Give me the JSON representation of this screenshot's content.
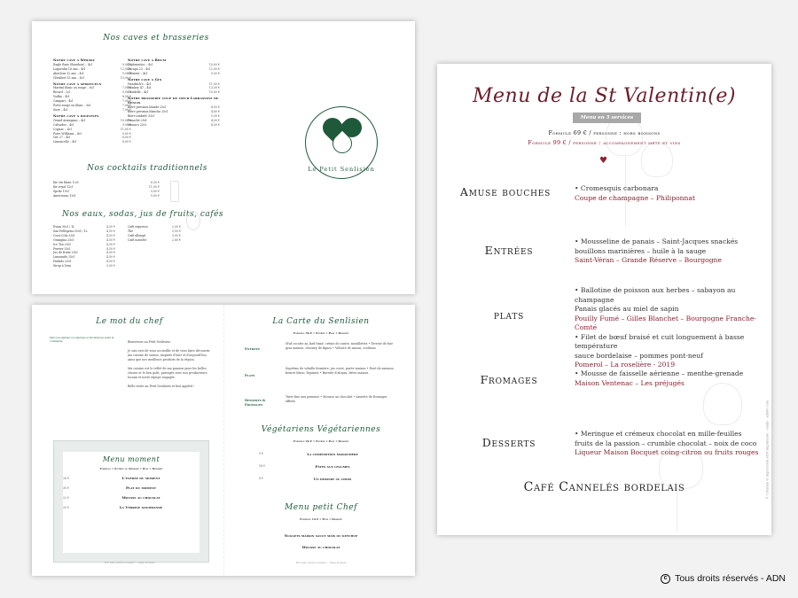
{
  "sheet_a": {
    "title_caves": "Nos caves et brasseries",
    "col1": [
      {
        "heading": "Notre cave à Whisky",
        "items": [
          [
            "Eagle Rare (Bourbon) – 4cl",
            "9,00 €"
          ],
          [
            "Lagavulin 16 ans – 4cl",
            "12,00 €"
          ],
          [
            "Aberlour 12 ans – 4cl",
            "9,00 €"
          ],
          [
            "Glenlivet 15 ans – 4cl",
            "10,00 €"
          ]
        ]
      },
      {
        "heading": "Notre cave à spiritueux",
        "items": [
          [
            "Martini blanc ou rouge – 6cl",
            "7,00 €"
          ],
          [
            "Ricard – 2cl",
            "5,50 €"
          ],
          [
            "Vodka – 4cl",
            "8,00 €"
          ],
          [
            "Campari – 4cl",
            "7,00 €"
          ],
          [
            "Porto rouge ou blanc – 6cl",
            "7,00 €"
          ],
          [
            "Suze – 4cl",
            "7,00 €"
          ]
        ]
      },
      {
        "heading": "Notre cave à digestifs",
        "items": [
          [
            "Grand Armagnac – 4cl",
            "10,00 €"
          ],
          [
            "Calvados – 4cl",
            "9,00 €"
          ],
          [
            "Cognac – 4cl",
            "11,00 €"
          ],
          [
            "Poire Williams – 4cl",
            "9,00 €"
          ],
          [
            "Get 27 – 4cl",
            "8,00 €"
          ],
          [
            "Limoncello – 4cl",
            "8,00 €"
          ]
        ]
      }
    ],
    "col2": [
      {
        "heading": "Notre cave à Rhum",
        "items": [
          [
            "Diplomatico – 4cl",
            "10,00 €"
          ],
          [
            "Zacapa 23 – 4cl",
            "12,00 €"
          ],
          [
            "Clément – 4cl",
            "9,00 €"
          ]
        ]
      },
      {
        "heading": "Notre cave à Gin",
        "items": [
          [
            "Hendrick's – 4cl",
            "11,00 €"
          ],
          [
            "Monkey 47 – 4cl",
            "13,00 €"
          ],
          [
            "Citadelle – 4cl",
            "10,00 €"
          ]
        ]
      },
      {
        "heading": "Notre brasserie coup de cœur Larrassine de Senlis",
        "items": [
          [
            "Bière pression blonde 25cl",
            "4,50 €"
          ],
          [
            "Bière pression blanche 25cl",
            "4,80 €"
          ],
          [
            "Bière ambrée 33cl",
            "5,50 €"
          ],
          [
            "Panaché 25cl",
            "4,00 €"
          ],
          [
            "Monaco 25cl",
            "4,50 €"
          ]
        ]
      }
    ],
    "logo_text": "Le Petit Senlisien",
    "title_cocktails": "Nos cocktails traditionnels",
    "cocktails": [
      [
        "Kir vin blanc 12cl",
        "6,50 €"
      ],
      [
        "Kir royal 12cl",
        "11,00 €"
      ],
      [
        "Spritz 15cl",
        "9,00 €"
      ],
      [
        "Americano 15cl",
        "9,00 €"
      ]
    ],
    "title_softs": "Nos eaux, sodas, jus de fruits, cafés",
    "softs1": [
      [
        "Evian 50cl / 1L",
        "4,50 €"
      ],
      [
        "San Pellegrino 50cl / 1L",
        "4,50 €"
      ],
      [
        "Coca-Cola 33cl",
        "4,50 €"
      ],
      [
        "Orangina 25cl",
        "4,50 €"
      ],
      [
        "Ice Tea 25cl",
        "4,50 €"
      ],
      [
        "Perrier 33cl",
        "4,50 €"
      ],
      [
        "Jus de fruits 25cl",
        "4,50 €"
      ],
      [
        "Limonade 25cl",
        "4,50 €"
      ],
      [
        "Diabolo 25cl",
        "4,50 €"
      ],
      [
        "Sirop à l'eau",
        "3,00 €"
      ]
    ],
    "softs2": [
      [
        "Café expresso",
        "2,50 €"
      ],
      [
        "Thé",
        "3,50 €"
      ],
      [
        "Café allongé",
        "3,00 €"
      ],
      [
        "Café noisette",
        "2,80 €"
      ]
    ]
  },
  "sheet_b": {
    "title_chef": "Le mot du chef",
    "chef_p1": "Bienvenue au Petit Senlisien.",
    "chef_p2": "Je suis ravi de vous accueillir et de vous faire découvrir ma cuisine de saison, inspirée d'hier et d'aujourd'hui, ainsi que nos meilleurs produits de la région.",
    "chef_p3": "Ma cuisine est le reflet de ma passion pour les belles choses et le bon goût, partagée avec nos producteurs locaux et notre équipe engagée.",
    "chef_p4": "Belle visite au Petit Senlisien et bon appétit !",
    "chef_note": "Merci de signaler vos allergies et intolérances avant la commande.",
    "title_moment": "Menu moment",
    "moment_sub": "Formule • Entrée ou Dessert • Plat • Dessert",
    "moment_items": [
      "L'entrée du moment",
      "Plat du moment",
      "Mousse au chocolat",
      "La Verrine gourmande"
    ],
    "moment_prices": [
      "26 €",
      "30 €",
      "22 €",
      "20 €"
    ],
    "title_carte": "La Carte du Senlisien",
    "carte_sub": "Formule 36 € • Entrée • Plat • Dessert",
    "carte_labels": [
      "Entrées",
      "Plats",
      "Desserts & Fromages"
    ],
    "carte_entrees": "Œuf cocotte au lard fumé, crème de comté, mouillettes • Terrine de foie gras maison, chutney de figues • Velouté de saison, croûtons",
    "carte_plats": "Suprême de volaille fermière, jus corsé, purée maison • Pavé de saumon, beurre blanc, légumes • Bavette d'aloyau, frites maison",
    "carte_desserts": "Tarte fine aux pommes • Mousse au chocolat • Assiette de fromages affinés",
    "title_vege": "Végétariens Végétariennes",
    "vege_sub": "Formule 26 € • Entrée • Plat • Dessert",
    "vege_items": [
      "La composition maraîchère",
      "Pâtes aux légumes",
      "Un dessert au choix"
    ],
    "vege_prices": [
      "9 €",
      "16 €",
      "8 €"
    ],
    "title_petit": "Menu petit Chef",
    "petit_sub": "Formule 14 € • Plat • Dessert",
    "petit_items": [
      "Nuggets maison sauce maïs ou ketchup",
      "Mousse au chocolat"
    ],
    "footer_left": "Prix nets, service compris — taxes incluses",
    "footer_right": "Prix nets, service compris — taxes incluses"
  },
  "menu": {
    "title": "Menu de la St Valentin(e)",
    "badge": "Menu en 5 services",
    "formula_1": "Formule 69 € / personne : hors boissons",
    "formula_2": "Formule 99 € / personne : accompagnement mets et vins",
    "heart": "♥",
    "courses": [
      {
        "name": "Amuse bouches",
        "lines": [
          {
            "text": "• Cromesquis carbonara",
            "wine": false
          },
          {
            "text": "Coupe de champagne – Philiponnat",
            "wine": true
          }
        ]
      },
      {
        "name": "Entrées",
        "lines": [
          {
            "text": "• Mousseline de panais – Saint-Jacques snackés",
            "wine": false
          },
          {
            "text": "bouillons marinières – huile à la sauge",
            "wine": false
          },
          {
            "text": "Saint-Véran – Grande Réserve – Bourgogne",
            "wine": true
          }
        ]
      },
      {
        "name": "plats",
        "lines": [
          {
            "text": "• Ballotine de poisson aux herbes – sabayon au champagne",
            "wine": false
          },
          {
            "text": "Panais glacés au miel de sapin",
            "wine": false
          },
          {
            "text": "Pouilly Fumé – Gilles Blanchet – Bourgogne Franche-Comté",
            "wine": true
          },
          {
            "text": "• Filet de bœuf braisé et cuit longuement à basse température",
            "wine": false
          },
          {
            "text": "sauce bordelaise – pommes pont-neuf",
            "wine": false
          },
          {
            "text": "Pomerol – La roselière - 2019",
            "wine": true
          }
        ]
      },
      {
        "name": "Fromages",
        "lines": [
          {
            "text": "• Mousse de faisselle aérienne – menthe-grenade",
            "wine": false
          },
          {
            "text": "Maison Ventenac – Les préjugés",
            "wine": true
          }
        ]
      },
      {
        "name": "Desserts",
        "lines": [
          {
            "text": "• Meringue et crémeux chocolat en mille-feuilles",
            "wine": false
          },
          {
            "text": "fruits de la passion – crumble chocolat – noix de coco",
            "wine": false
          },
          {
            "text": "Liqueur Maison Bocquet coing-citron ou fruits rouges",
            "wine": true
          }
        ]
      }
    ],
    "cafe": "Café Cannelés bordelais",
    "side_credit": "© Création & impression ADN imprimerie - senlis - adn60.com"
  },
  "copyright": "Tous droits réservés - ADN",
  "colors": {
    "green": "#1e5a3a",
    "burgundy": "#6b1e2a",
    "wine": "#8a1f2e",
    "badge_grey": "#a8a8a8"
  }
}
